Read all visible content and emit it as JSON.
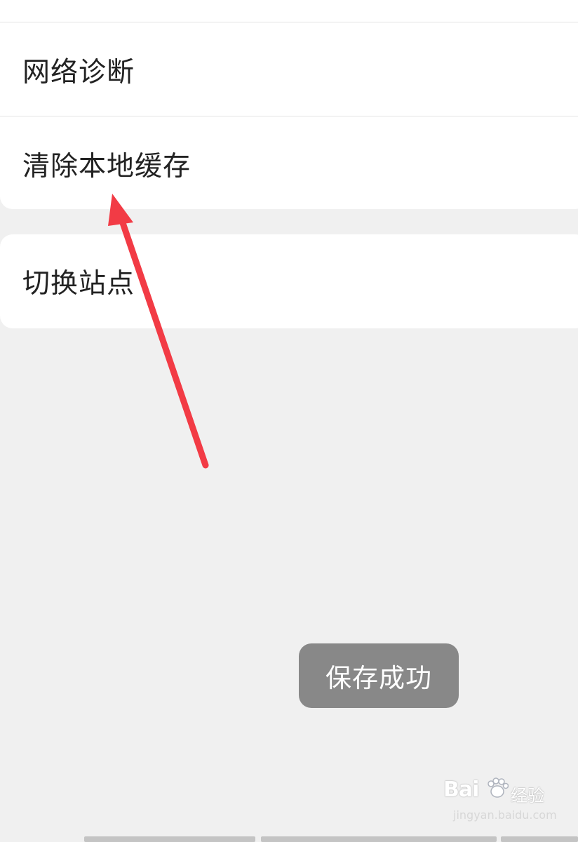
{
  "menu": {
    "network_diagnosis": "网络诊断",
    "clear_local_cache": "清除本地缓存",
    "switch_site": "切换站点"
  },
  "toast": {
    "message": "保存成功"
  },
  "annotation": {
    "arrow_color": "#f23b45"
  },
  "watermark": {
    "logo_prefix": "Bai",
    "logo_suffix": "经验",
    "url": "jingyan.baidu.com",
    "paw_icon": "paw-icon"
  },
  "colors": {
    "background": "#f0f0f0",
    "card": "#ffffff",
    "text": "#222222",
    "toast": "#888888"
  }
}
